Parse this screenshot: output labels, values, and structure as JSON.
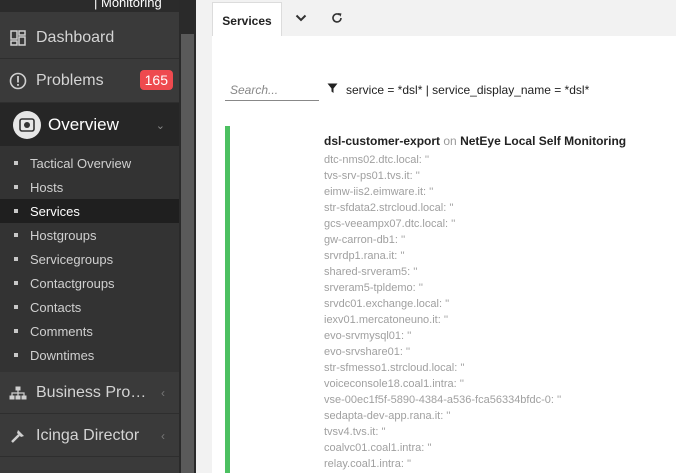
{
  "sidebar": {
    "logo_text": "| Monitoring",
    "items": [
      {
        "label": "Dashboard",
        "icon": "dashboard-icon"
      },
      {
        "label": "Problems",
        "icon": "alert-icon",
        "badge": "165"
      },
      {
        "label": "Overview",
        "icon": "overview-icon"
      },
      {
        "label": "Business Proce…",
        "icon": "business-process-icon"
      },
      {
        "label": "Icinga Director",
        "icon": "director-icon"
      }
    ],
    "overview_sub": [
      {
        "label": "Tactical Overview"
      },
      {
        "label": "Hosts"
      },
      {
        "label": "Services"
      },
      {
        "label": "Hostgroups"
      },
      {
        "label": "Servicegroups"
      },
      {
        "label": "Contactgroups"
      },
      {
        "label": "Contacts"
      },
      {
        "label": "Comments"
      },
      {
        "label": "Downtimes"
      }
    ]
  },
  "main": {
    "tab_label": "Services",
    "search_placeholder": "Search...",
    "filter_text": "service = *dsl* | service_display_name = *dsl*",
    "service": {
      "name": "dsl-customer-export",
      "on": "on",
      "host": "NetEye Local Self Monitoring",
      "status_color": "#4cc061",
      "output_lines": [
        "dtc-nms02.dtc.local: ''",
        "tvs-srv-ps01.tvs.it: ''",
        "eimw-iis2.eimware.it: ''",
        "str-sfdata2.strcloud.local: ''",
        "gcs-veeampx07.dtc.local: ''",
        "gw-carron-db1: ''",
        "srvrdp1.rana.it: ''",
        "shared-srveram5: ''",
        "srveram5-tpldemo: ''",
        "srvdc01.exchange.local: ''",
        "iexv01.mercatoneuno.it: ''",
        "evo-srvmysql01: ''",
        "evo-srvshare01: ''",
        "str-sfmesso1.strcloud.local: ''",
        "voiceconsole18.coal1.intra: ''",
        "vse-00ec1f5f-5890-4384-a536-fca56334bfdc-0: ''",
        "sedapta-dev-app.rana.it: ''",
        "tvsv4.tvs.it: ''",
        "coalvc01.coal1.intra: ''",
        "relay.coal1.intra: ''"
      ]
    }
  },
  "colors": {
    "sidebar_bg": "#3a3a3a",
    "badge": "#ee4a4f",
    "ok_green": "#4cc061"
  }
}
